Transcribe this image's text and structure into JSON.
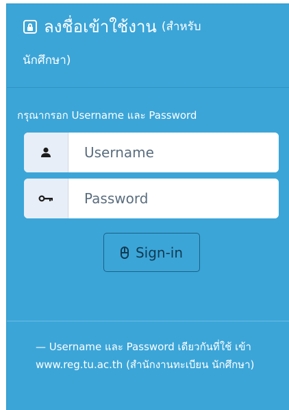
{
  "header": {
    "title": "ลงชื่อเข้าใช้งาน",
    "subtitle_line1": "(สำหรับ",
    "subtitle_line2": "นักศึกษา)"
  },
  "form": {
    "instruction": "กรุณากรอก Username และ Password",
    "username": {
      "placeholder": "Username",
      "value": "",
      "icon": "user-icon"
    },
    "password": {
      "placeholder": "Password",
      "value": "",
      "icon": "key-icon"
    },
    "signin_label": "Sign-in",
    "signin_icon": "mouse-icon"
  },
  "footer": {
    "note": "— Username และ Password เดียวกันที่ใช้ เข้า www.reg.tu.ac.th (สำนักงานทะเบียน นักศึกษา)"
  },
  "colors": {
    "panel": "#3ba5d8",
    "addon": "#e8eef7",
    "button_text": "#123a52"
  }
}
